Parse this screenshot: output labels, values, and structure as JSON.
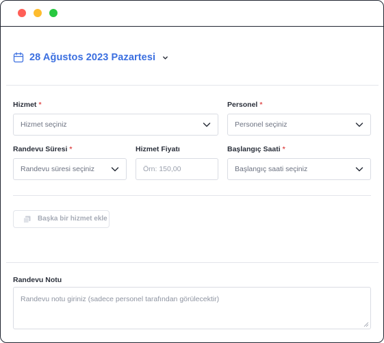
{
  "window": {
    "controls": [
      "close",
      "minimize",
      "maximize"
    ],
    "colors": {
      "close": "#ff5f57",
      "minimize": "#febc2e",
      "maximize": "#28c840"
    }
  },
  "header": {
    "date_text": "28 Ağustos 2023 Pazartesi",
    "calendar_icon": "calendar-icon",
    "dropdown_icon": "chevron-down-icon",
    "accent_color": "#3b6fe0"
  },
  "form": {
    "service": {
      "label": "Hizmet",
      "required": "*",
      "placeholder": "Hizmet seçiniz"
    },
    "staff": {
      "label": "Personel",
      "required": "*",
      "placeholder": "Personel seçiniz"
    },
    "duration": {
      "label": "Randevu Süresi",
      "required": "*",
      "placeholder": "Randevu süresi seçiniz"
    },
    "price": {
      "label": "Hizmet Fiyatı",
      "placeholder": "Örn: 150,00"
    },
    "start_time": {
      "label": "Başlangıç Saati",
      "required": "*",
      "placeholder": "Başlangıç saati seçiniz"
    },
    "add_service_button": "Başka bir hizmet ekle",
    "note": {
      "label": "Randevu Notu",
      "placeholder": "Randevu notu giriniz (sadece personel tarafından görülecektir)"
    }
  }
}
